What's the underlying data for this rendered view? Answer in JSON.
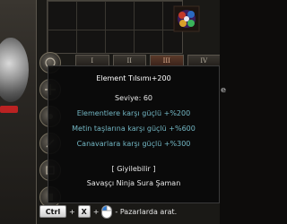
{
  "window": {
    "right_edge_letter": "e"
  },
  "inventory": {
    "tabs": [
      {
        "label": "I",
        "active": false
      },
      {
        "label": "II",
        "active": false
      },
      {
        "label": "III",
        "active": true
      },
      {
        "label": "IV",
        "active": false
      }
    ]
  },
  "tooltip": {
    "title": "Element Tılsımı+200",
    "level": "Seviye: 60",
    "bonuses": [
      "Elementlere karşı güçlü +%200",
      "Metin taşlarına karşı güçlü +%600",
      "Canavarlara karşı güçlü +%300"
    ],
    "wearable": "[ Giyilebilir ]",
    "classes": "Savaşçı Ninja Sura Şaman"
  },
  "hint": {
    "key1": "Ctrl",
    "plus1": "+",
    "key2": "X",
    "plus2": "+",
    "text": "- Pazarlarda arat."
  },
  "colors": {
    "tooltip_text": "#e8e8e8",
    "bonus_text": "#73b7c4",
    "panel_bg": "#1a1916"
  },
  "icons": [
    "talisman-item-icon",
    "inventory-slot-icon",
    "mouse-icon"
  ]
}
